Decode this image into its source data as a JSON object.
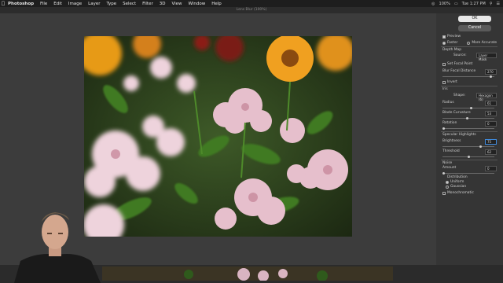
{
  "menubar": {
    "app": "Photoshop",
    "items": [
      "File",
      "Edit",
      "Image",
      "Layer",
      "Type",
      "Select",
      "Filter",
      "3D",
      "View",
      "Window",
      "Help"
    ],
    "status_right": [
      "100%",
      "Tue 1:27 PM"
    ]
  },
  "window": {
    "title": "Lens Blur (100%)"
  },
  "panel": {
    "ok_label": "OK",
    "cancel_label": "Cancel",
    "preview_label": "Preview",
    "faster_label": "Faster",
    "more_accurate_label": "More Accurate",
    "depth_map_heading": "Depth Map",
    "source_label": "Source:",
    "source_value": "Layer Mask",
    "set_focal_point_label": "Set Focal Point",
    "blur_focal_distance_label": "Blur Focal Distance",
    "blur_focal_distance_value": "270",
    "invert_label": "Invert",
    "iris_heading": "Iris",
    "shape_label": "Shape:",
    "shape_value": "Hexagon (6)",
    "radius_label": "Radius",
    "radius_value": "61",
    "blade_curvature_label": "Blade Curvature",
    "blade_curvature_value": "53",
    "rotation_label": "Rotation",
    "rotation_value": "0",
    "specular_heading": "Specular Highlights",
    "brightness_label": "Brightness",
    "brightness_value": "75",
    "threshold_label": "Threshold",
    "threshold_value": "62",
    "noise_heading": "Noise",
    "amount_label": "Amount",
    "amount_value": "0",
    "distribution_heading": "Distribution",
    "uniform_label": "Uniform",
    "gaussian_label": "Gaussian",
    "monochromatic_label": "Monochromatic",
    "slider_levels": {
      "blur_focal_distance": 0.95,
      "radius": 0.55,
      "blade_curvature": 0.48,
      "rotation": 0.0,
      "brightness": 0.75,
      "threshold": 0.5,
      "amount": 0.0
    }
  },
  "colors": {
    "menubar_bg": "#1e1e1e",
    "panel_bg": "#353535",
    "workspace_bg": "#3c3c3c",
    "ok_button": "#e8e8e8"
  }
}
